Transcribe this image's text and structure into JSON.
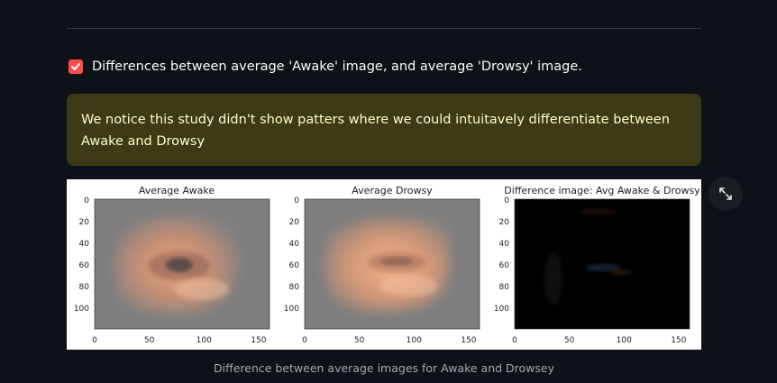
{
  "checkbox": {
    "label": "Differences between average 'Awake' image, and average 'Drowsy' image.",
    "checked": true,
    "color": "#ff4b4b"
  },
  "alert": {
    "text": "We notice this study didn't show patters where we could intuitavely differentiate between Awake and Drowsy",
    "background": "#3d3b15",
    "text_color": "#fffbc9"
  },
  "figure": {
    "panels": [
      {
        "title": "Average Awake"
      },
      {
        "title": "Average Drowsy"
      },
      {
        "title": "Difference image: Avg Awake & Drowsy"
      }
    ],
    "x_ticks": [
      "0",
      "50",
      "100",
      "150"
    ],
    "y_ticks": [
      "0",
      "20",
      "40",
      "60",
      "80",
      "100"
    ]
  },
  "expand_icon": "expand-arrows-icon",
  "caption": "Difference between average images for Awake and Drowsey"
}
